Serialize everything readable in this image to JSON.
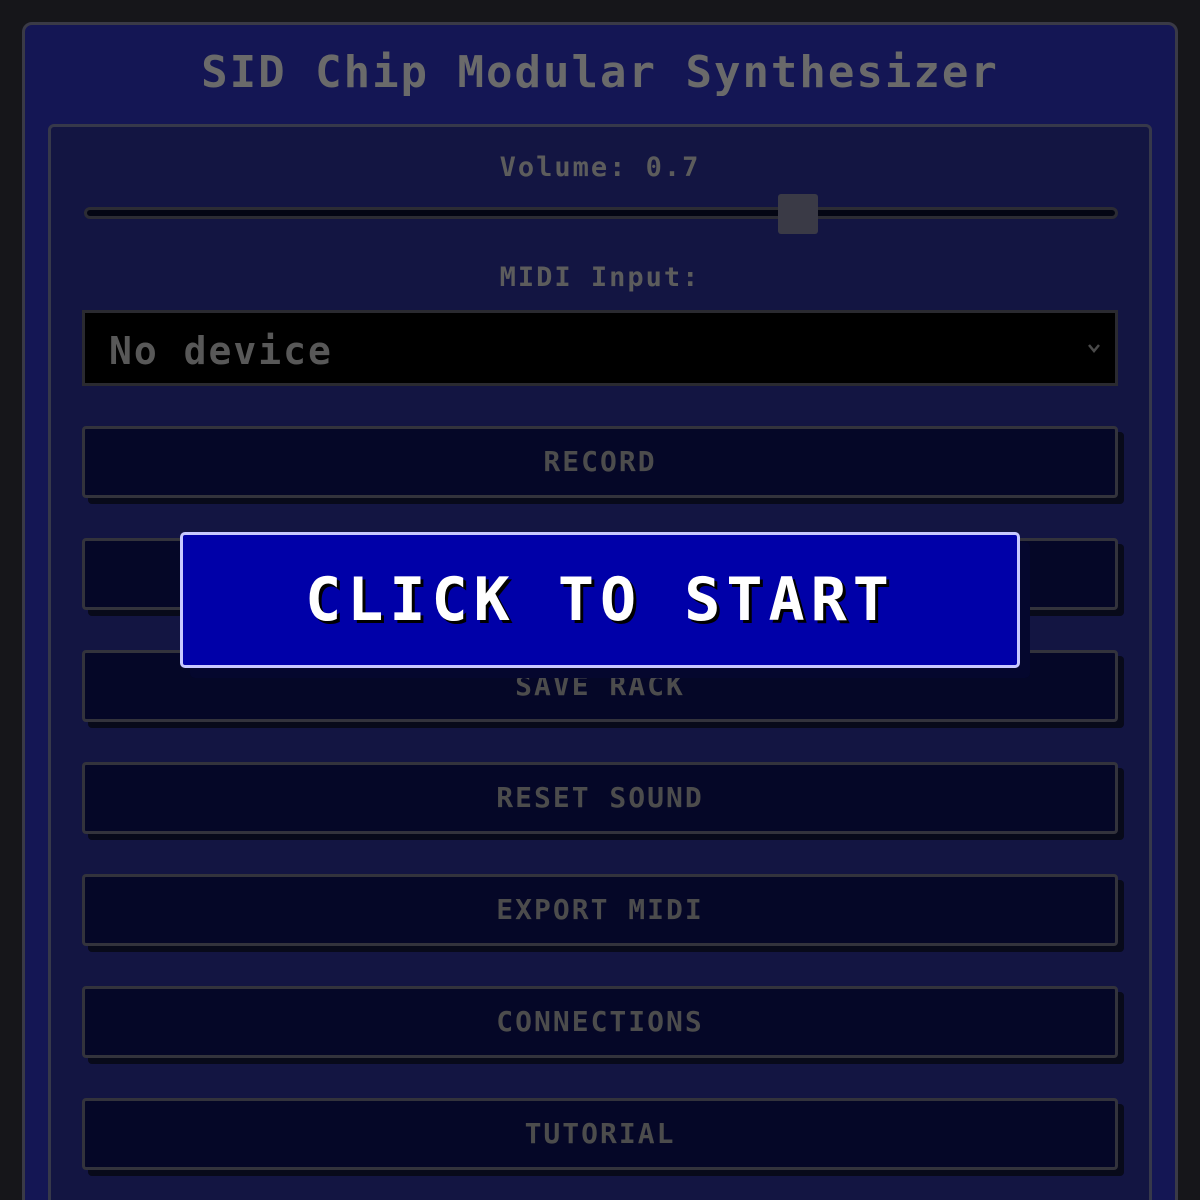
{
  "app": {
    "title": "SID Chip Modular Synthesizer"
  },
  "controls": {
    "volume_label": "Volume: 0.7",
    "volume_value": 0.7,
    "midi_label": "MIDI Input:",
    "midi_selected": "No device"
  },
  "buttons": {
    "record": "RECORD",
    "hidden_button": "",
    "save_rack": "SAVE RACK",
    "reset_sound": "RESET SOUND",
    "export_midi": "EXPORT MIDI",
    "connections": "CONNECTIONS",
    "tutorial": "TUTORIAL"
  },
  "overlay": {
    "start_label": "CLICK TO START"
  },
  "icons": {
    "select_chevron": "chevron-down-icon"
  },
  "colors": {
    "window_bg": "#141654",
    "overlay_button_bg": "#0000a8",
    "overlay_button_text": "#ffffff"
  }
}
